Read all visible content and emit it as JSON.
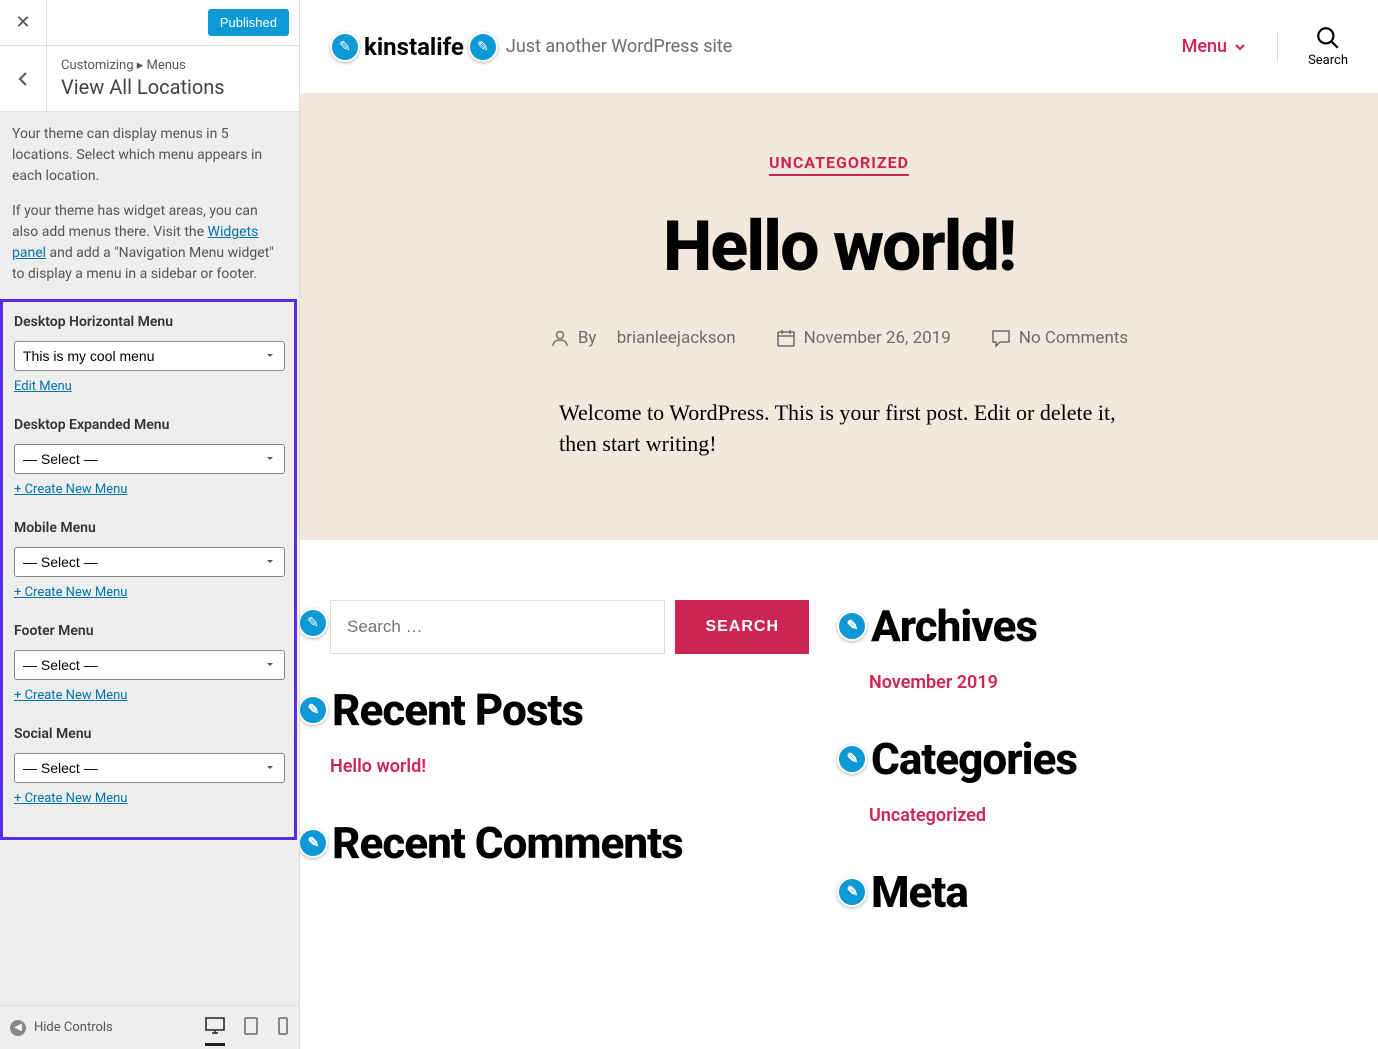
{
  "sidebar": {
    "publish_label": "Published",
    "breadcrumb": "Customizing ▸ Menus",
    "section_title": "View All Locations",
    "intro1": "Your theme can display menus in 5 locations. Select which menu appears in each location.",
    "intro2_before": "If your theme has widget areas, you can also add menus there. Visit the ",
    "widgets_panel_link": "Widgets panel",
    "intro2_after": " and add a \"Navigation Menu widget\" to display a menu in a sidebar or footer.",
    "locations": [
      {
        "label": "Desktop Horizontal Menu",
        "value": "This is my cool menu",
        "action": "Edit Menu"
      },
      {
        "label": "Desktop Expanded Menu",
        "value": "— Select —",
        "action": "+ Create New Menu"
      },
      {
        "label": "Mobile Menu",
        "value": "— Select —",
        "action": "+ Create New Menu"
      },
      {
        "label": "Footer Menu",
        "value": "— Select —",
        "action": "+ Create New Menu"
      },
      {
        "label": "Social Menu",
        "value": "— Select —",
        "action": "+ Create New Menu"
      }
    ],
    "hide_controls": "Hide Controls"
  },
  "preview": {
    "site_title": "kinstalife",
    "site_tagline": "Just another WordPress site",
    "menu_label": "Menu",
    "search_label": "Search",
    "category": "UNCATEGORIZED",
    "post_title": "Hello world!",
    "by_label": "By",
    "author": "brianleejackson",
    "date": "November 26, 2019",
    "comments": "No Comments",
    "excerpt": "Welcome to WordPress. This is your first post. Edit or delete it, then start writing!",
    "search_placeholder": "Search …",
    "search_btn": "SEARCH",
    "widgets": {
      "recent_posts": "Recent Posts",
      "recent_posts_item": "Hello world!",
      "recent_comments": "Recent Comments",
      "archives": "Archives",
      "archives_item": "November 2019",
      "categories": "Categories",
      "categories_item": "Uncategorized",
      "meta": "Meta"
    }
  }
}
